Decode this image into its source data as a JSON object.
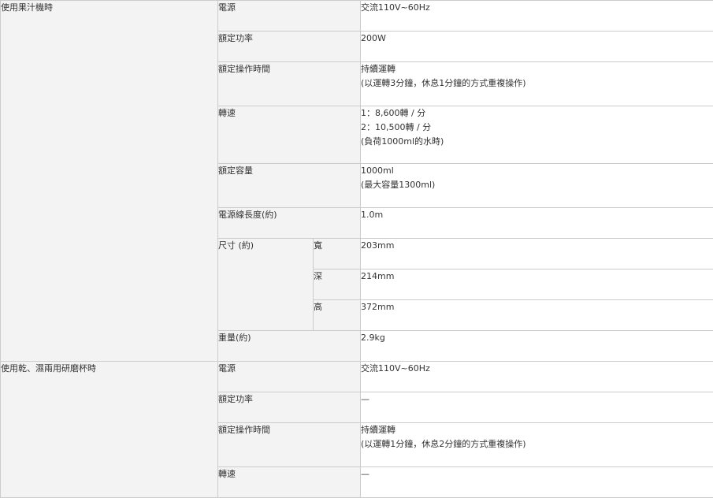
{
  "groups": [
    {
      "name": "使用果汁機時",
      "rows": [
        {
          "label": "電源",
          "lines": [
            "交流110V~60Hz"
          ]
        },
        {
          "label": "額定功率",
          "lines": [
            "200W"
          ]
        },
        {
          "label": "額定操作時間",
          "lines": [
            "持續運轉",
            "(以運轉3分鐘，休息1分鐘的方式重複操作)"
          ]
        },
        {
          "label": "轉速",
          "lines": [
            "1：8,600轉 / 分",
            "2：10,500轉 / 分",
            "(負荷1000ml的水時)"
          ]
        },
        {
          "label": "額定容量",
          "lines": [
            "1000ml",
            "(最大容量1300ml)"
          ]
        },
        {
          "label": "電源線長度(約)",
          "lines": [
            "1.0m"
          ]
        },
        {
          "label": "尺寸 (約)",
          "subs": [
            {
              "name": "寬",
              "value": "203mm"
            },
            {
              "name": "深",
              "value": "214mm"
            },
            {
              "name": "高",
              "value": "372mm"
            }
          ]
        },
        {
          "label": "重量(約)",
          "lines": [
            "2.9kg"
          ]
        }
      ]
    },
    {
      "name": "使用乾、濕兩用研磨杯時",
      "rows": [
        {
          "label": "電源",
          "lines": [
            "交流110V~60Hz"
          ]
        },
        {
          "label": "額定功率",
          "lines": [
            "—"
          ]
        },
        {
          "label": "額定操作時間",
          "lines": [
            "持續運轉",
            "(以運轉1分鐘，休息2分鐘的方式重複操作)"
          ]
        },
        {
          "label": "轉速",
          "lines": [
            "—"
          ]
        }
      ]
    }
  ]
}
